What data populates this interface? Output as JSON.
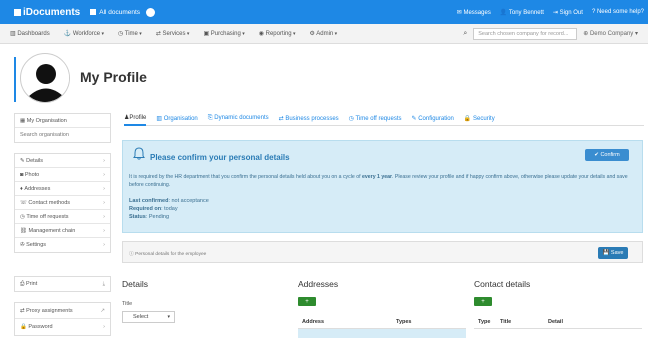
{
  "topbar": {
    "brand": "iDocuments",
    "all_documents": "All documents",
    "messages": "Messages",
    "user": "Tony Bennett",
    "sign_out": "Sign Out",
    "help": "Need some help?"
  },
  "navbar": {
    "items": [
      "Dashboards",
      "Workforce",
      "Time",
      "Services",
      "Purchasing",
      "Reporting",
      "Admin"
    ],
    "search_placeholder": "Search chosen company for record...",
    "company": "Demo Company"
  },
  "profile": {
    "title": "My Profile"
  },
  "sidebar_top": {
    "my_organisation": "My Organisation",
    "search_organisation": "Search organisation"
  },
  "sidebar_menu": [
    "Details",
    "Photo",
    "Addresses",
    "Contact methods",
    "Time off requests",
    "Management chain",
    "Settings"
  ],
  "sidebar_print": "Print",
  "sidebar_bottom": [
    "Proxy assignments",
    "Password"
  ],
  "tabs": [
    "Profile",
    "Organisation",
    "Dynamic documents",
    "Business processes",
    "Time off requests",
    "Configuration",
    "Security"
  ],
  "notice": {
    "heading": "Please confirm your personal details",
    "confirm_label": "Confirm",
    "body_1": "It is required by the HR department that you confirm the personal details held about you on a cycle of",
    "body_every": "every 1 year",
    "body_2": ". Please review your profile and if happy confirm above, otherwise please update your details and save before continuing.",
    "last_confirmed_label": "Last confirmed",
    "last_confirmed_value": ": not acceptance",
    "required_on_label": "Required on",
    "required_on_value": ": today",
    "status_label": "Status",
    "status_value": ": Pending"
  },
  "save_bar": {
    "text": "Personal details for the employee",
    "save_label": "Save"
  },
  "details": {
    "title": "Details",
    "title_field_label": "Title",
    "title_value": "Select"
  },
  "addresses": {
    "title": "Addresses",
    "add_label": "+",
    "columns": [
      "Address",
      "Types"
    ]
  },
  "contact": {
    "title": "Contact details",
    "add_label": "+",
    "columns": [
      "Type",
      "Title",
      "Detail"
    ]
  },
  "colors": {
    "topbar": "#1e88e5",
    "notice_bg": "#d6ecf7",
    "success": "#2e8b2e"
  }
}
